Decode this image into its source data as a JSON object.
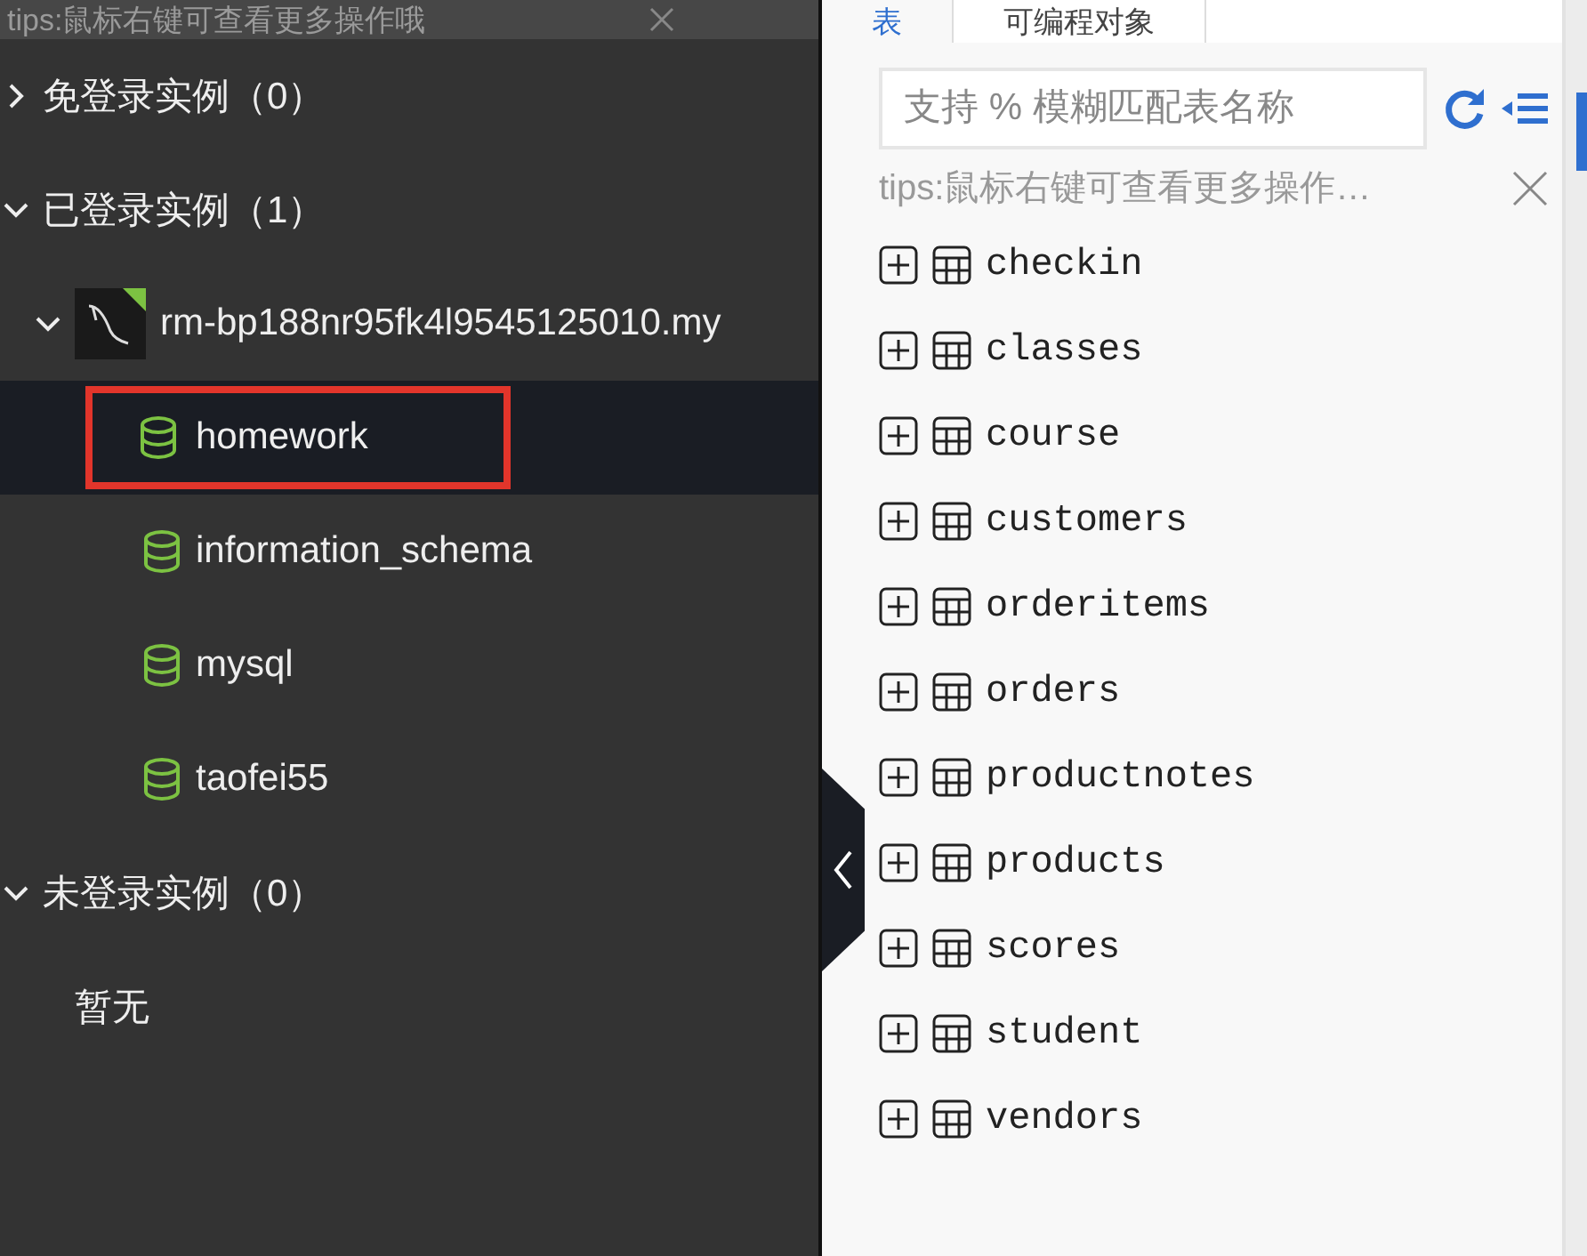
{
  "left_panel": {
    "tips": "tips:鼠标右键可查看更多操作哦",
    "groups": [
      {
        "label": "免登录实例（0）",
        "expanded": false
      },
      {
        "label": "已登录实例（1）",
        "expanded": true,
        "children": [
          {
            "label": "rm-bp188nr95fk4l9545125010.my",
            "expanded": true,
            "children": [
              {
                "label": "homework",
                "selected": true
              },
              {
                "label": "information_schema",
                "selected": false
              },
              {
                "label": "mysql",
                "selected": false
              },
              {
                "label": "taofei55",
                "selected": false
              }
            ]
          }
        ]
      },
      {
        "label": "未登录实例（0）",
        "expanded": true,
        "empty_text": "暂无"
      }
    ]
  },
  "right_panel": {
    "tabs": [
      {
        "label": "表",
        "selected": true
      },
      {
        "label": "可编程对象",
        "selected": false
      }
    ],
    "search": {
      "placeholder": "支持 % 模糊匹配表名称"
    },
    "tips": "tips:鼠标右键可查看更多操作…",
    "tables": [
      "checkin",
      "classes",
      "course",
      "customers",
      "orderitems",
      "orders",
      "productnotes",
      "products",
      "scores",
      "student",
      "vendors"
    ]
  }
}
